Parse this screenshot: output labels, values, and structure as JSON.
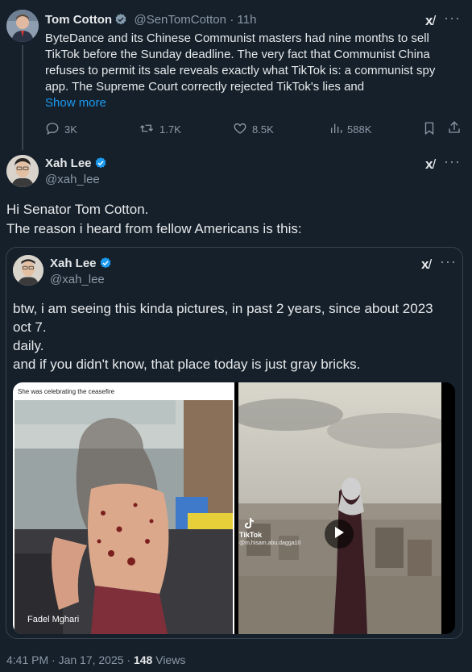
{
  "reply_tweet": {
    "author_name": "Tom Cotton",
    "author_handle": "@SenTomCotton",
    "time": "· 11h",
    "text": "ByteDance and its Chinese Communist masters had nine months to sell TikTok before the Sunday deadline. The very fact that Communist China refuses to permit its sale reveals exactly what TikTok is: a communist spy app. The Supreme Court correctly rejected TikTok's lies and",
    "show_more": "Show more",
    "replies": "3K",
    "retweets": "1.7K",
    "likes": "8.5K",
    "views": "588K"
  },
  "main_tweet": {
    "author_name": "Xah Lee",
    "author_handle": "@xah_lee",
    "line1": "Hi Senator Tom Cotton.",
    "line2": "The reason i heard from fellow Americans is this:",
    "timestamp": "4:41 PM · Jan 17, 2025 ·",
    "views_count": "148",
    "views_label": "Views"
  },
  "quoted_tweet": {
    "author_name": "Xah Lee",
    "author_handle": "@xah_lee",
    "line1": "btw, i am seeing this kinda pictures, in past 2 years, since about 2023",
    "line2": "oct 7.",
    "line3": "daily.",
    "line4": "and if you didn't know, that place today is just gray bricks.",
    "image_left_caption": "She was celebrating the ceasefire",
    "image_left_watermark": "Fadel Mghari",
    "image_right_brand": "TikTok",
    "image_right_handle": "@m.hisam.abu.dagga10"
  },
  "icons": [
    "verified-badge-icon",
    "grok-icon",
    "more-icon",
    "reply-icon",
    "retweet-icon",
    "like-icon",
    "views-icon",
    "bookmark-icon",
    "share-icon",
    "play-icon"
  ],
  "colors": {
    "background": "#15202b",
    "accent": "#1d9bf0",
    "muted": "#8b98a5",
    "text": "#e7e9ea",
    "border": "#38444d"
  }
}
